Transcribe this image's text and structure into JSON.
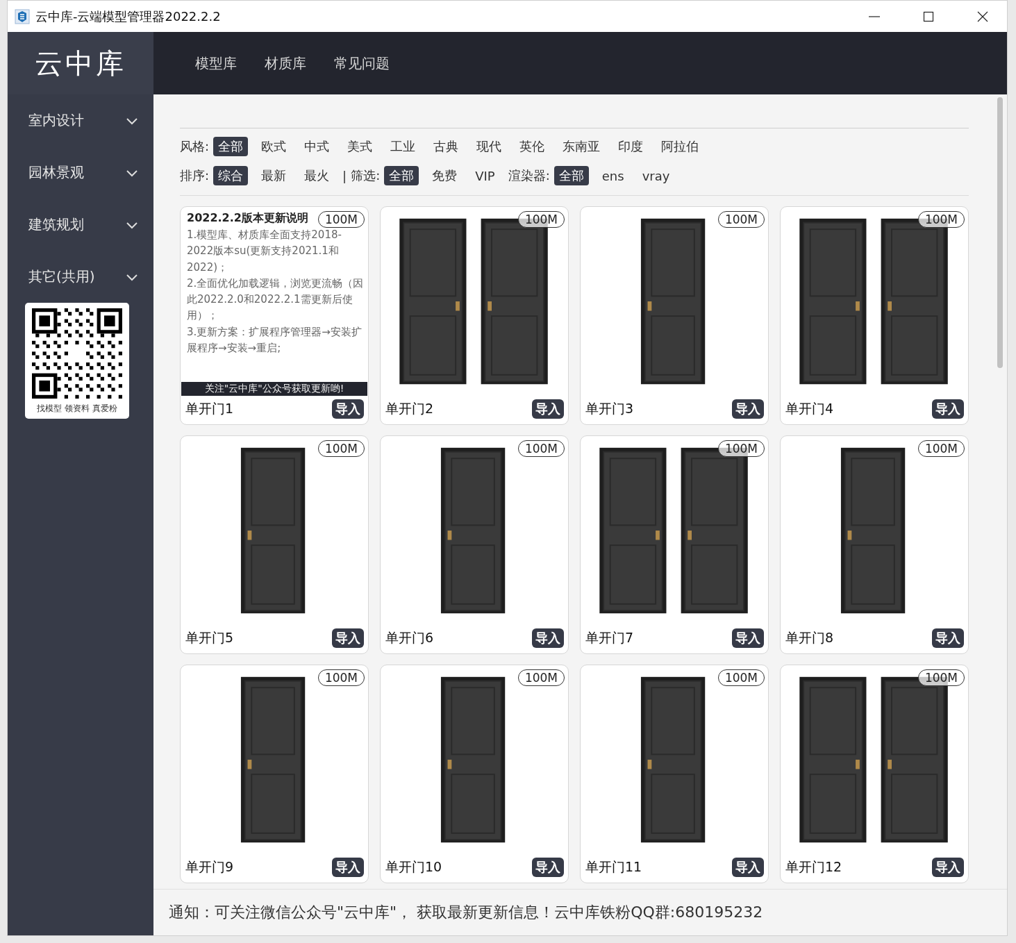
{
  "window": {
    "title": "云中库-云端模型管理器2022.2.2"
  },
  "sidebar": {
    "logo": "云中库",
    "items": [
      {
        "label": "室内设计",
        "expanded": false
      },
      {
        "label": "园林景观",
        "expanded": false
      },
      {
        "label": "建筑规划",
        "expanded": false
      },
      {
        "label": "其它(共用)",
        "expanded": false
      }
    ],
    "qr_caption": "找模型 领资料 真爱粉"
  },
  "nav": {
    "tabs": [
      {
        "label": "模型库",
        "selected": false
      },
      {
        "label": "材质库",
        "selected": false
      },
      {
        "label": "常见问题",
        "selected": false
      }
    ]
  },
  "filters": {
    "style": {
      "label": "风格:",
      "options": [
        {
          "label": "全部",
          "selected": true
        },
        {
          "label": "欧式",
          "selected": false
        },
        {
          "label": "中式",
          "selected": false
        },
        {
          "label": "美式",
          "selected": false
        },
        {
          "label": "工业",
          "selected": false
        },
        {
          "label": "古典",
          "selected": false
        },
        {
          "label": "现代",
          "selected": false
        },
        {
          "label": "英伦",
          "selected": false
        },
        {
          "label": "东南亚",
          "selected": false
        },
        {
          "label": "印度",
          "selected": false
        },
        {
          "label": "阿拉伯",
          "selected": false
        }
      ]
    },
    "sort": {
      "label": "排序:",
      "options": [
        {
          "label": "综合",
          "selected": true
        },
        {
          "label": "最新",
          "selected": false
        },
        {
          "label": "最火",
          "selected": false
        }
      ]
    },
    "separator": "|",
    "filter": {
      "label": "筛选:",
      "options": [
        {
          "label": "全部",
          "selected": true
        },
        {
          "label": "免费",
          "selected": false
        },
        {
          "label": "VIP",
          "selected": false
        }
      ]
    },
    "renderer": {
      "label": "渲染器:",
      "options": [
        {
          "label": "全部",
          "selected": true
        },
        {
          "label": "ens",
          "selected": false
        },
        {
          "label": "vray",
          "selected": false
        }
      ]
    }
  },
  "cards": [
    {
      "kind": "notice",
      "name": "单开门1",
      "size": "100M",
      "button": "导入",
      "notice": {
        "title": "2022.2.2版本更新说明",
        "paragraphs": [
          "1.模型库、材质库全面支持2018-2022版本su(更新支持2021.1和2022)；",
          "2.全面优化加载逻辑，浏览更流畅（因此2022.2.0和2022.2.1需更新后使用）；",
          "3.更新方案：扩展程序管理器→安装扩展程序→安装→重启;"
        ],
        "banner": "关注\"云中库\"公众号获取更新哟!"
      }
    },
    {
      "kind": "double",
      "name": "单开门2",
      "size": "100M",
      "button": "导入"
    },
    {
      "kind": "single",
      "name": "单开门3",
      "size": "100M",
      "button": "导入"
    },
    {
      "kind": "double",
      "name": "单开门4",
      "size": "100M",
      "button": "导入"
    },
    {
      "kind": "single",
      "name": "单开门5",
      "size": "100M",
      "button": "导入"
    },
    {
      "kind": "single",
      "name": "单开门6",
      "size": "100M",
      "button": "导入"
    },
    {
      "kind": "double",
      "name": "单开门7",
      "size": "100M",
      "button": "导入"
    },
    {
      "kind": "single",
      "name": "单开门8",
      "size": "100M",
      "button": "导入"
    },
    {
      "kind": "single",
      "name": "单开门9",
      "size": "100M",
      "button": "导入"
    },
    {
      "kind": "single",
      "name": "单开门10",
      "size": "100M",
      "button": "导入"
    },
    {
      "kind": "single",
      "name": "单开门11",
      "size": "100M",
      "button": "导入"
    },
    {
      "kind": "double",
      "name": "单开门12",
      "size": "100M",
      "button": "导入"
    }
  ],
  "status_bar": "通知：可关注微信公众号\"云中库\"， 获取最新更新信息！云中库铁粉QQ群:680195232"
}
